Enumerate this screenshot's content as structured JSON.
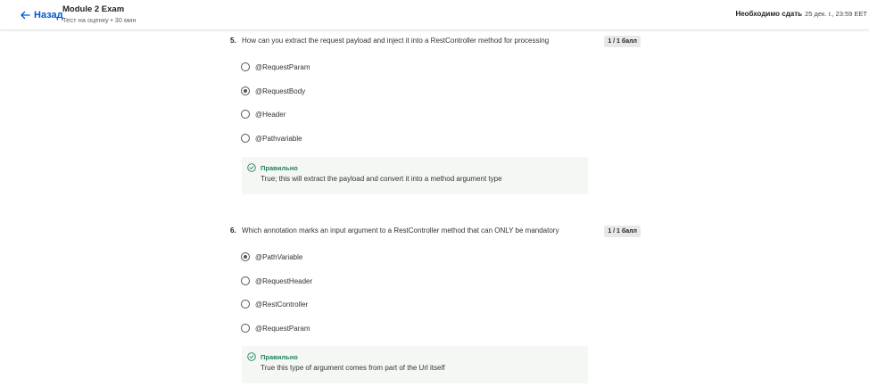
{
  "header": {
    "back_label": "Назад",
    "title": "Module 2 Exam",
    "subtitle": "Тест на оценку • 30 мин",
    "due_label": "Необходимо сдать",
    "due_date": "25 дек. г., 23:59 EET"
  },
  "questions": [
    {
      "number": "5.",
      "text": "How can you extract the request payload and inject it into a RestController method for processing",
      "score": "1 / 1 балл",
      "options": [
        {
          "label": "@RequestParam",
          "selected": false
        },
        {
          "label": "@RequestBody",
          "selected": true
        },
        {
          "label": "@Header",
          "selected": false
        },
        {
          "label": "@Pathvariable",
          "selected": false
        }
      ],
      "feedback": {
        "title": "Правильно",
        "text": "True; this will extract the payload and convert it into a method argument type"
      }
    },
    {
      "number": "6.",
      "text": "Which annotation marks an input argument to a RestController method that can ONLY be mandatory",
      "score": "1 / 1 балл",
      "options": [
        {
          "label": "@PathVariable",
          "selected": true
        },
        {
          "label": "@RequestHeader",
          "selected": false
        },
        {
          "label": "@RestController",
          "selected": false
        },
        {
          "label": "@RequestParam",
          "selected": false
        }
      ],
      "feedback": {
        "title": "Правильно",
        "text": "True this type of argument comes from part of the Url itself"
      }
    }
  ],
  "colors": {
    "link": "#0056d2",
    "correct": "#1f8354",
    "feedback_bg": "#f5f7f5",
    "score_badge_bg": "#e8e8e8"
  }
}
